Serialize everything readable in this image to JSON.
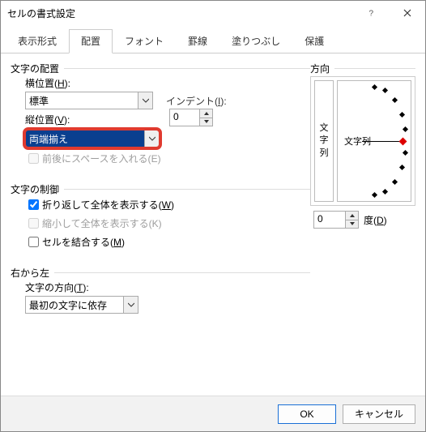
{
  "window": {
    "title": "セルの書式設定"
  },
  "tabs": {
    "t0": "表示形式",
    "t1": "配置",
    "t2": "フォント",
    "t3": "罫線",
    "t4": "塗りつぶし",
    "t5": "保護"
  },
  "alignment": {
    "group_title": "文字の配置",
    "h_label_pre": "横位置(",
    "h_label_key": "H",
    "h_label_post": "):",
    "h_value": "標準",
    "v_label_pre": "縦位置(",
    "v_label_key": "V",
    "v_label_post": "):",
    "v_value": "両端揃え",
    "indent_label_pre": "インデント(",
    "indent_label_key": "I",
    "indent_label_post": "):",
    "indent_value": "0",
    "space_label_pre": "前後にスペースを入れる(",
    "space_label_key": "E",
    "space_label_post": ")"
  },
  "control": {
    "group_title": "文字の制御",
    "wrap_pre": "折り返して全体を表示する(",
    "wrap_key": "W",
    "wrap_post": ")",
    "shrink_pre": "縮小して全体を表示する(K)",
    "merge_pre": "セルを結合する(",
    "merge_key": "M",
    "merge_post": ")"
  },
  "rtl": {
    "group_title": "右から左",
    "dir_label_pre": "文字の方向(",
    "dir_label_key": "T",
    "dir_label_post": "):",
    "dir_value": "最初の文字に依存"
  },
  "orientation": {
    "group_title": "方向",
    "vertical_text_1": "文",
    "vertical_text_2": "字",
    "vertical_text_3": "列",
    "dial_label": "文字列",
    "degree_value": "0",
    "degree_label_pre": "度(",
    "degree_label_key": "D",
    "degree_label_post": ")"
  },
  "buttons": {
    "ok": "OK",
    "cancel": "キャンセル"
  }
}
